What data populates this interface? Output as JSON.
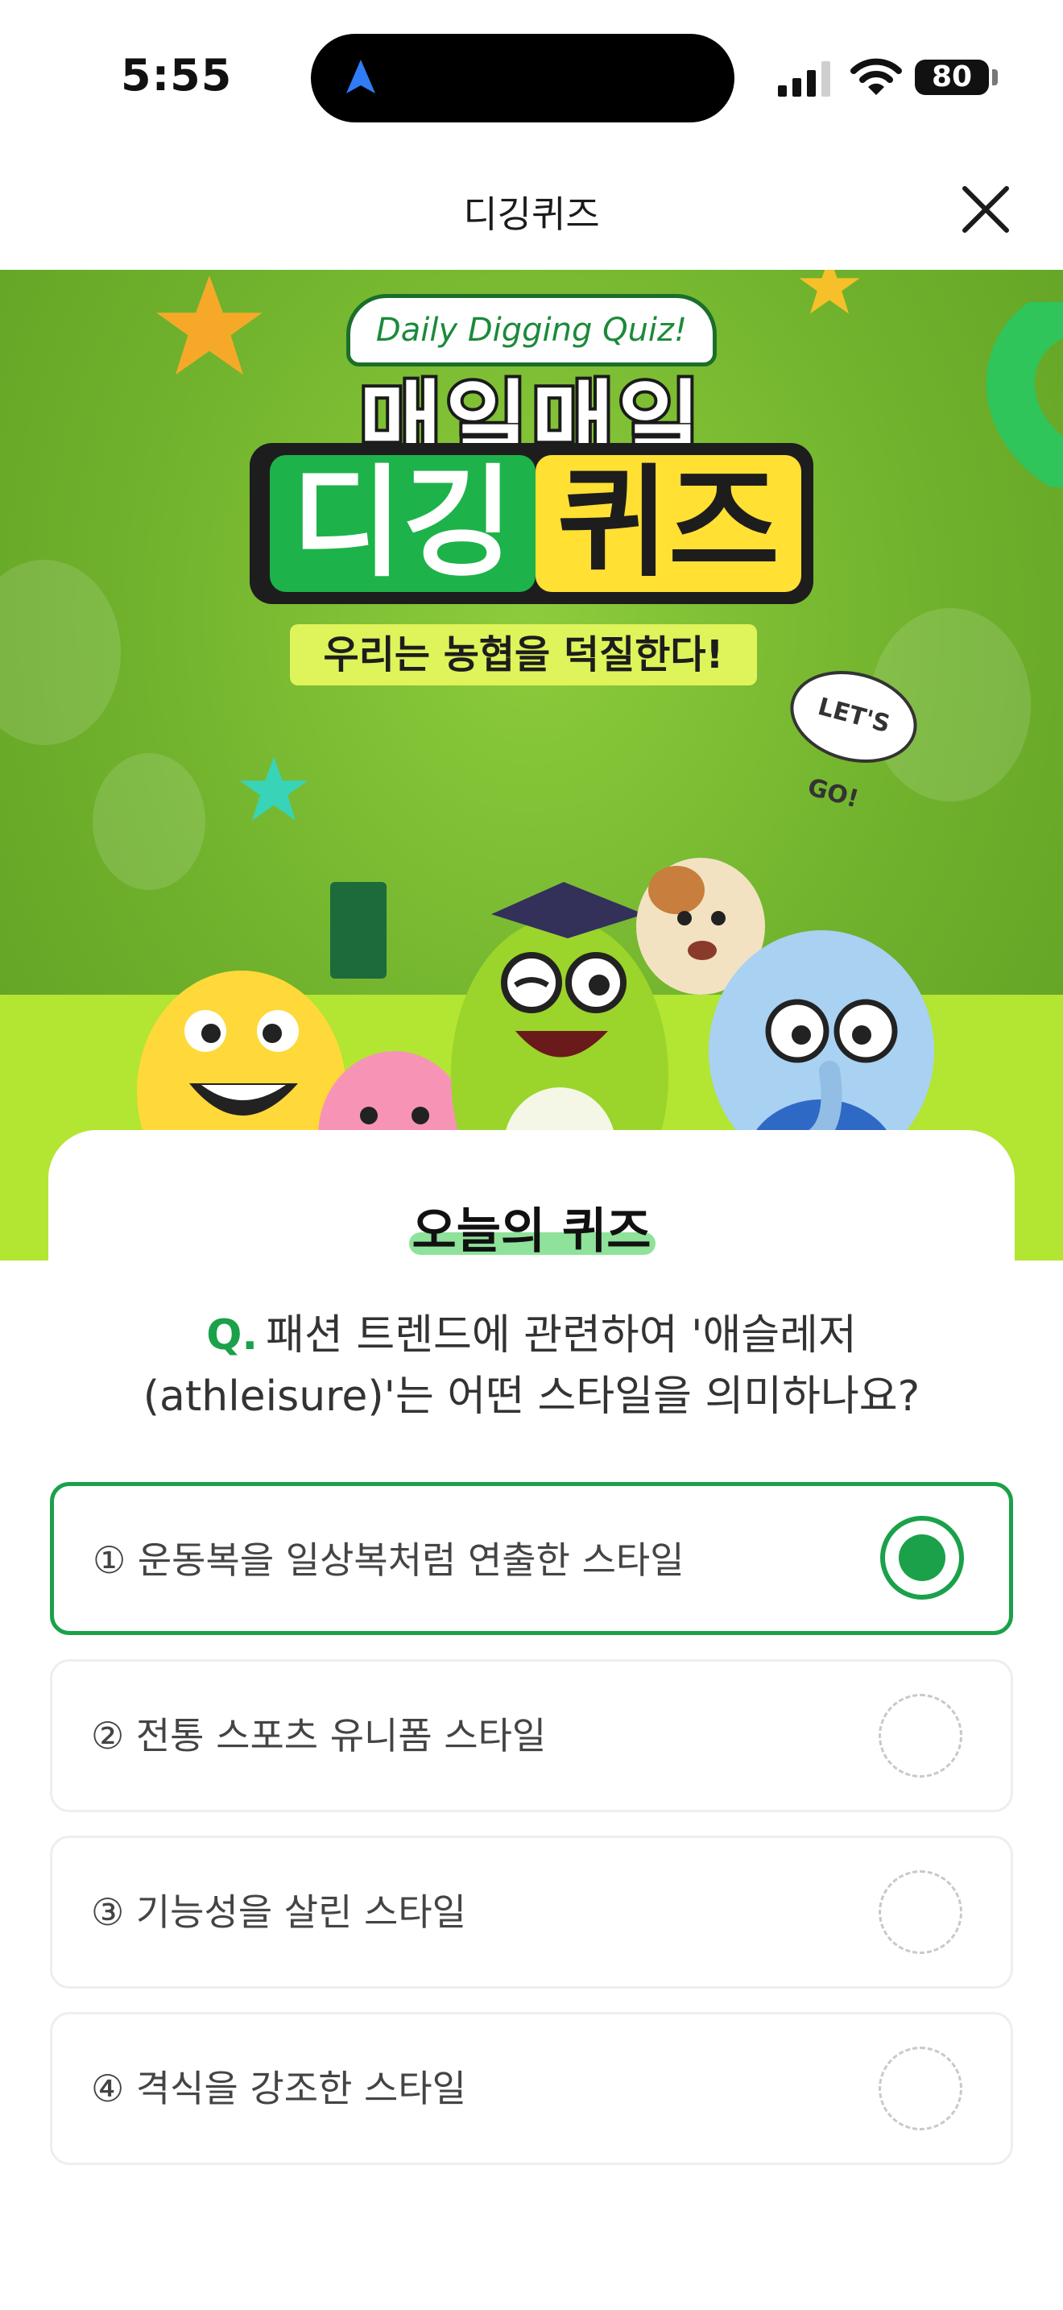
{
  "status_bar": {
    "time": "5:55",
    "battery": "80"
  },
  "header": {
    "title": "디깅퀴즈"
  },
  "banner": {
    "badge": "Daily Digging Quiz!",
    "title_line1": "매일매일",
    "title_part_green": "디깅",
    "title_part_yellow": "퀴즈",
    "tagline": "우리는 농협을 덕질한다!",
    "bubble": "LET'S GO!"
  },
  "quiz": {
    "heading": "오늘의 퀴즈",
    "q_mark": "Q.",
    "question": "패션 트렌드에 관련하여 '애슬레저 (athleisure)'는 어떤 스타일을 의미하나요?",
    "options": [
      {
        "label": "① 운동복을 일상복처럼 연출한 스타일",
        "selected": true
      },
      {
        "label": "② 전통 스포츠 유니폼 스타일",
        "selected": false
      },
      {
        "label": "③ 기능성을 살린 스타일",
        "selected": false
      },
      {
        "label": "④ 격식을 강조한 스타일",
        "selected": false
      }
    ]
  },
  "colors": {
    "accent": "#1aa14a",
    "banner_green": "#6fb12c",
    "ground": "#b3e533",
    "yellow": "#ffe033"
  },
  "icons": {
    "navigation": "location-arrow-icon",
    "signal": "cellular-signal-icon",
    "wifi": "wifi-icon",
    "close": "close-icon"
  }
}
